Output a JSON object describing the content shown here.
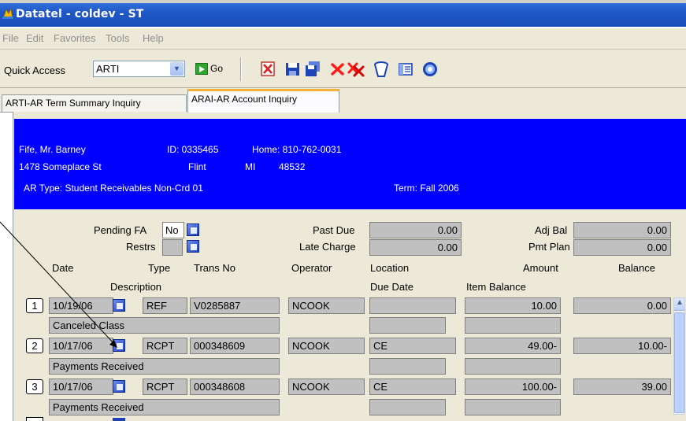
{
  "window": {
    "title": "Datatel - coldev - ST"
  },
  "menu": [
    "File",
    "Edit",
    "Favorites",
    "Tools",
    "Help"
  ],
  "toolbar": {
    "quick_access_label": "Quick Access",
    "quick_access_value": "ARTI",
    "go_label": "Go"
  },
  "tabs": [
    {
      "label": "ARTI-AR Term Summary Inquiry",
      "active": false
    },
    {
      "label": "ARAI-AR Account Inquiry",
      "active": true
    }
  ],
  "person": {
    "name": "Fife, Mr. Barney",
    "id": "ID: 0335465",
    "home": "Home: 810-762-0031",
    "address": "1478 Someplace St",
    "city": "Flint",
    "state": "MI",
    "zip": "48532",
    "ar_type": "AR Type:  Student Receivables Non-Crd 01",
    "term": "Term:  Fall 2006"
  },
  "summary": {
    "pending_fa_label": "Pending FA",
    "pending_fa_value": "No",
    "restrs_label": "Restrs",
    "restrs_value": "",
    "past_due_label": "Past Due",
    "past_due_value": "0.00",
    "late_charge_label": "Late Charge",
    "late_charge_value": "0.00",
    "adj_bal_label": "Adj Bal",
    "adj_bal_value": "0.00",
    "pmt_plan_label": "Pmt Plan",
    "pmt_plan_value": "0.00"
  },
  "columns": {
    "date": "Date",
    "type": "Type",
    "trans_no": "Trans No",
    "operator": "Operator",
    "location": "Location",
    "amount": "Amount",
    "balance": "Balance",
    "description": "Description",
    "due_date": "Due Date",
    "item_balance": "Item Balance"
  },
  "rows": [
    {
      "num": "1",
      "date": "10/19/06",
      "type": "REF",
      "trans_no": "V0285887",
      "operator": "NCOOK",
      "location": "",
      "amount": "10.00",
      "balance": "0.00",
      "description": "Canceled Class"
    },
    {
      "num": "2",
      "date": "10/17/06",
      "type": "RCPT",
      "trans_no": "000348609",
      "operator": "NCOOK",
      "location": "CE",
      "amount": "49.00-",
      "balance": "10.00-",
      "description": "Payments Received"
    },
    {
      "num": "3",
      "date": "10/17/06",
      "type": "RCPT",
      "trans_no": "000348608",
      "operator": "NCOOK",
      "location": "CE",
      "amount": "100.00-",
      "balance": "39.00",
      "description": "Payments Received"
    }
  ],
  "colors": {
    "title_bar": "#1f57c6",
    "header_band": "#0000ff",
    "tab_highlight": "#f6b23a"
  },
  "icons": [
    "app-icon",
    "go-arrow-icon",
    "cancel-icon",
    "save-icon",
    "save-all-icon",
    "delete-icon",
    "delete-all-icon",
    "trash-icon",
    "list-icon",
    "help-icon",
    "detail-icon",
    "scroll-up-icon"
  ]
}
